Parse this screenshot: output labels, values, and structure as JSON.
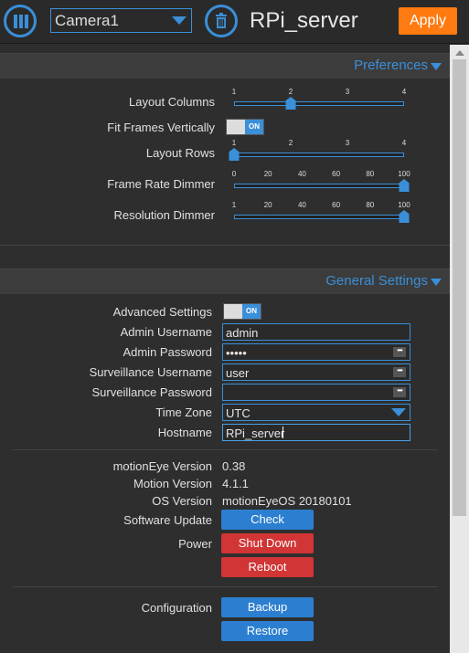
{
  "header": {
    "camera_select": "Camera1",
    "title": "RPi_server",
    "apply": "Apply"
  },
  "preferences": {
    "title": "Preferences",
    "layout_columns": {
      "label": "Layout Columns",
      "ticks": [
        "1",
        "2",
        "3",
        "4"
      ],
      "value": 2,
      "min": 1,
      "max": 4
    },
    "fit_frames": {
      "label": "Fit Frames Vertically",
      "state": "ON"
    },
    "layout_rows": {
      "label": "Layout Rows",
      "ticks": [
        "1",
        "2",
        "3",
        "4"
      ],
      "value": 1,
      "min": 1,
      "max": 4
    },
    "frame_rate_dimmer": {
      "label": "Frame Rate Dimmer",
      "ticks": [
        "0",
        "20",
        "40",
        "60",
        "80",
        "100"
      ],
      "value": 100,
      "min": 0,
      "max": 100
    },
    "resolution_dimmer": {
      "label": "Resolution Dimmer",
      "ticks": [
        "1",
        "20",
        "40",
        "60",
        "80",
        "100"
      ],
      "value": 100,
      "min": 1,
      "max": 100
    }
  },
  "general": {
    "title": "General Settings",
    "advanced": {
      "label": "Advanced Settings",
      "state": "ON"
    },
    "admin_username": {
      "label": "Admin Username",
      "value": "admin"
    },
    "admin_password": {
      "label": "Admin Password",
      "value": "•••••"
    },
    "surv_username": {
      "label": "Surveillance Username",
      "value": "user"
    },
    "surv_password": {
      "label": "Surveillance Password",
      "value": ""
    },
    "time_zone": {
      "label": "Time Zone",
      "value": "UTC"
    },
    "hostname": {
      "label": "Hostname",
      "value": "RPi_server"
    },
    "motioneye_version": {
      "label": "motionEye Version",
      "value": "0.38"
    },
    "motion_version": {
      "label": "Motion Version",
      "value": "4.1.1"
    },
    "os_version": {
      "label": "OS Version",
      "value": "motionEyeOS 20180101"
    },
    "software_update": {
      "label": "Software Update",
      "button": "Check"
    },
    "power": {
      "label": "Power",
      "shutdown": "Shut Down",
      "reboot": "Reboot"
    },
    "configuration": {
      "label": "Configuration",
      "backup": "Backup",
      "restore": "Restore"
    }
  },
  "colors": {
    "accent": "#3a8fd8",
    "apply": "#ff7a10",
    "danger": "#d13535",
    "background": "#2e2e2e"
  },
  "icons": {
    "menu": "columns-icon",
    "trash": "trash-icon",
    "dropdown": "chevron-down-icon",
    "password": "dots-icon"
  }
}
